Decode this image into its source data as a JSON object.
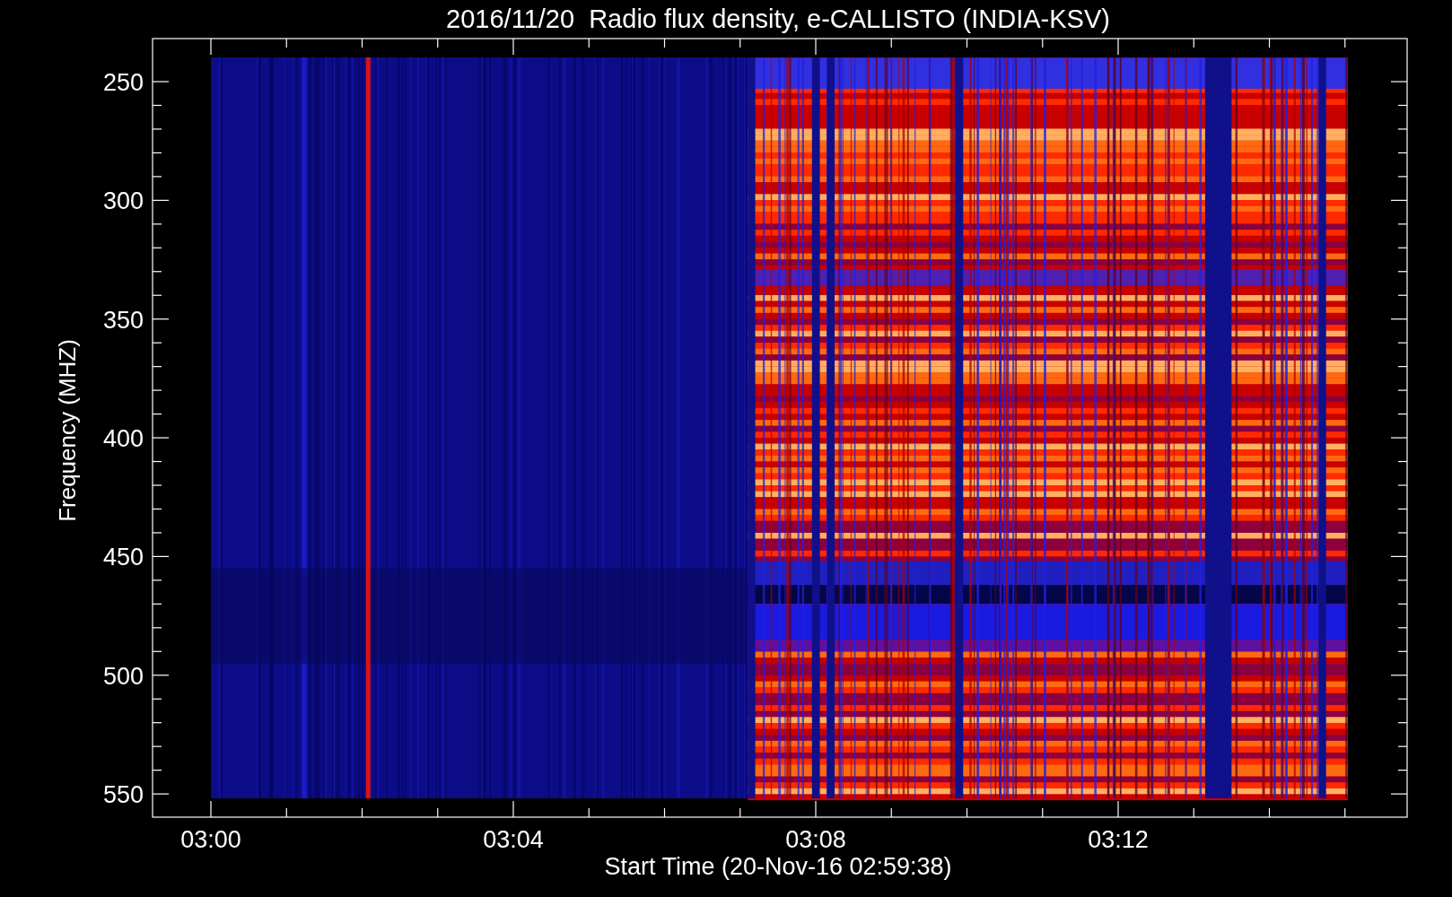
{
  "plot": {
    "title": "2016/11/20  Radio flux density, e-CALLISTO (INDIA-KSV)",
    "ylabel": "Frequency (MHZ)",
    "xlabel": "Start Time (20-Nov-16 02:59:38)",
    "y_tick_labels": [
      "250",
      "300",
      "350",
      "400",
      "450",
      "500",
      "550"
    ],
    "x_tick_labels": [
      "03:00",
      "03:04",
      "03:08",
      "03:12"
    ]
  }
}
